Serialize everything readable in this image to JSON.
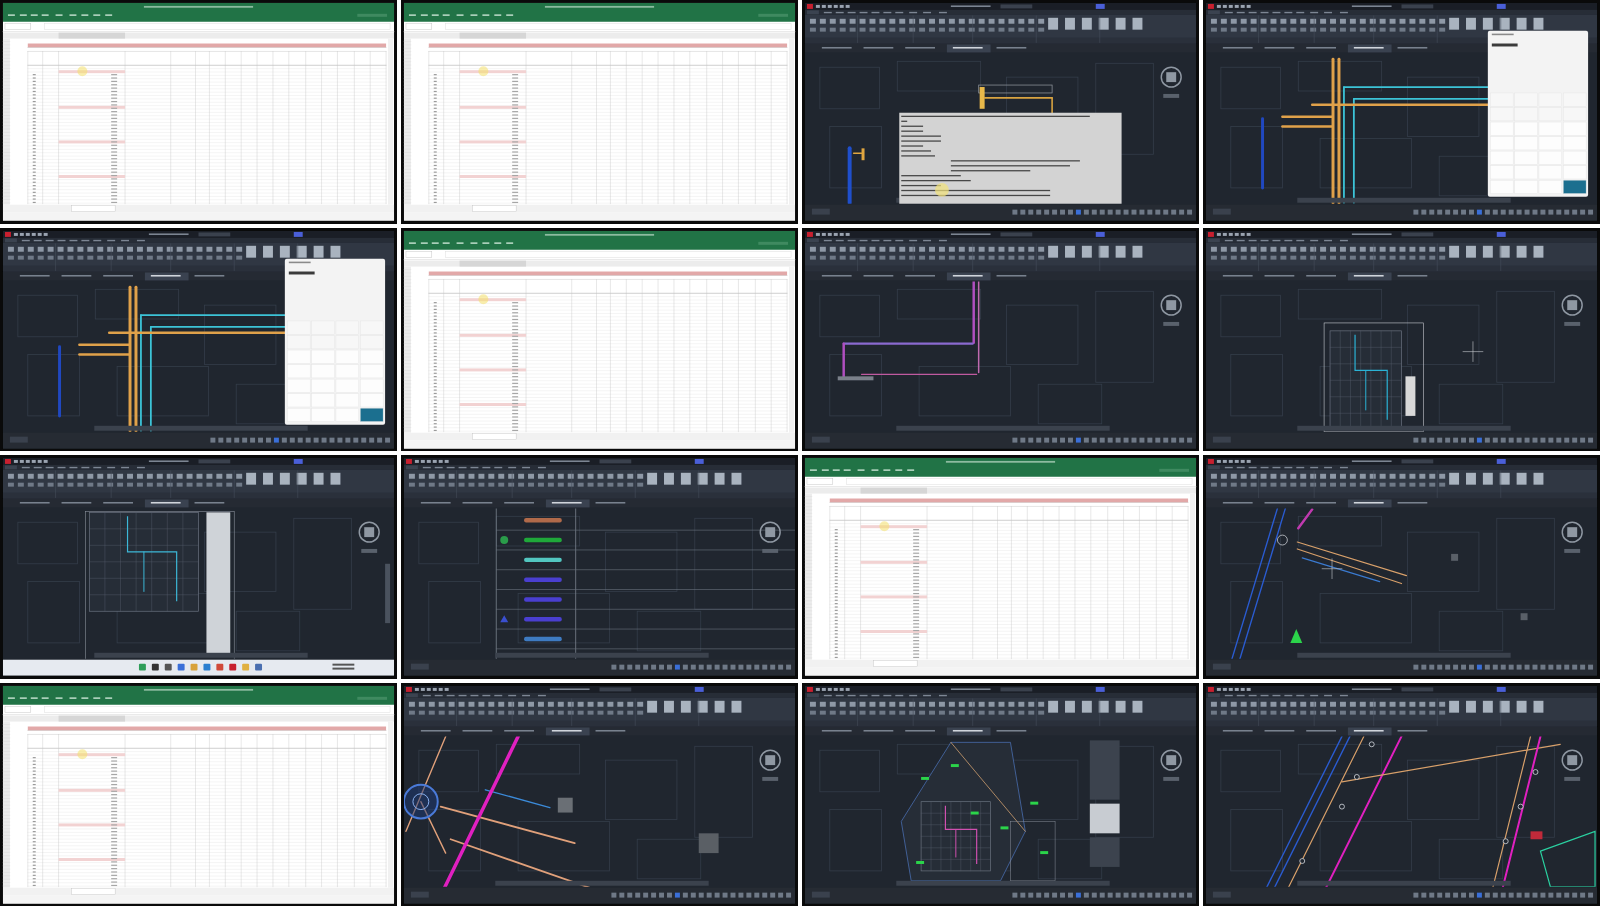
{
  "video_frames": [
    {
      "kind": "spreadsheet"
    },
    {
      "kind": "spreadsheet"
    },
    {
      "kind": "command"
    },
    {
      "kind": "calculator"
    },
    {
      "kind": "calculator"
    },
    {
      "kind": "spreadsheet"
    },
    {
      "kind": "pipework"
    },
    {
      "kind": "floorplan"
    },
    {
      "kind": "desktop"
    },
    {
      "kind": "legend"
    },
    {
      "kind": "spreadsheet"
    },
    {
      "kind": "siteplan"
    },
    {
      "kind": "spreadsheet"
    },
    {
      "kind": "junction"
    },
    {
      "kind": "overview"
    },
    {
      "kind": "network"
    }
  ]
}
